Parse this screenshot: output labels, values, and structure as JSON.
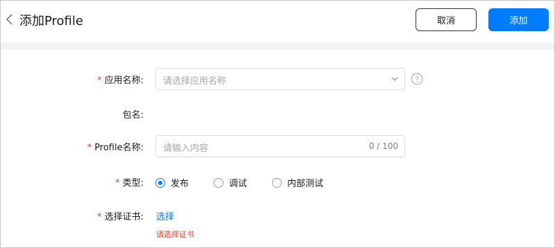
{
  "header": {
    "title": "添加Profile",
    "cancel_label": "取消",
    "add_label": "添加"
  },
  "form": {
    "app_name": {
      "required_mark": "*",
      "label": "应用名称:",
      "placeholder": "请选择应用名称"
    },
    "package": {
      "label": "包名:"
    },
    "profile_name": {
      "required_mark": "*",
      "label": "Profile名称:",
      "placeholder": "请输入内容",
      "counter": "0 / 100"
    },
    "type": {
      "required_mark": "*",
      "label": "类型:",
      "options": [
        {
          "label": "发布",
          "selected": true
        },
        {
          "label": "调试",
          "selected": false
        },
        {
          "label": "内部测试",
          "selected": false
        }
      ]
    },
    "certificate": {
      "required_mark": "*",
      "label": "选择证书:",
      "link": "选择",
      "error": "请选择证书"
    }
  },
  "colors": {
    "accent": "#007dff",
    "error": "#e84026",
    "band": "#f4f4f4"
  }
}
